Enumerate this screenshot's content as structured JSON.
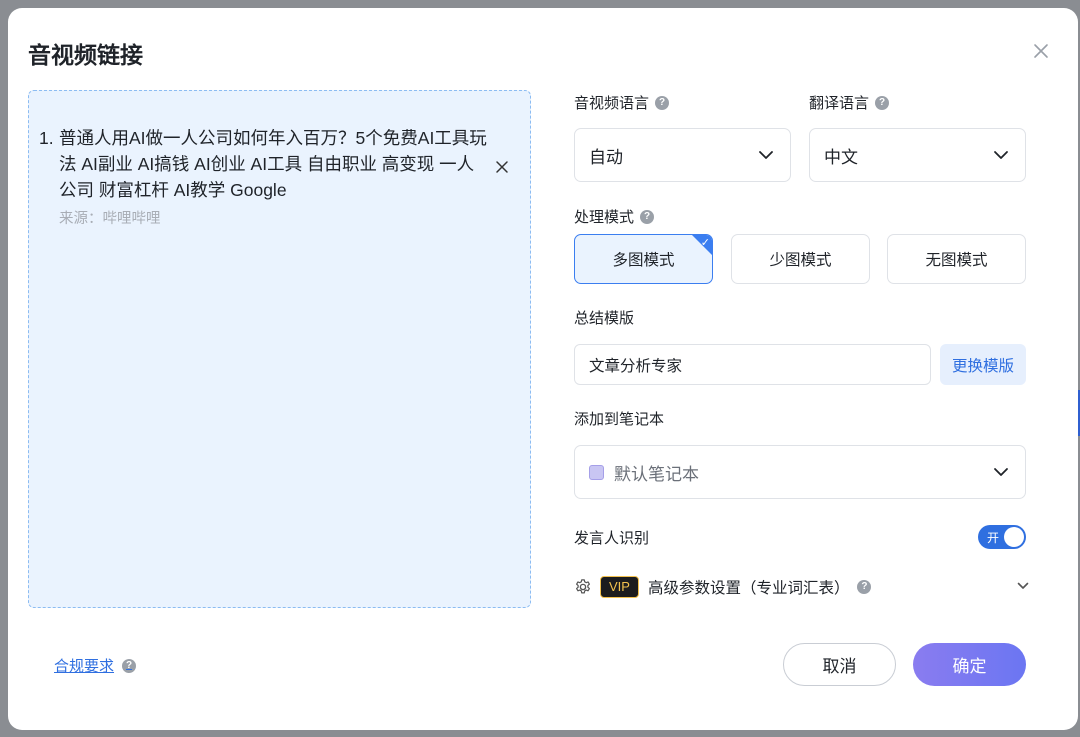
{
  "dialog": {
    "title": "音视频链接"
  },
  "link_list": {
    "items": [
      {
        "number": "1.",
        "title": "普通人用AI做一人公司如何年入百万？5个免费AI工具玩法 AI副业 AI搞钱 AI创业 AI工具 自由职业 高变现 一人公司 财富杠杆 AI教学 Google",
        "source": "来源：哔哩哔哩"
      }
    ]
  },
  "settings": {
    "audio_language": {
      "label": "音视频语言",
      "value": "自动"
    },
    "translate_language": {
      "label": "翻译语言",
      "value": "中文"
    },
    "process_mode": {
      "label": "处理模式",
      "options": [
        "多图模式",
        "少图模式",
        "无图模式"
      ],
      "selected": "多图模式"
    },
    "summary_template": {
      "label": "总结模版",
      "value": "文章分析专家",
      "change_button": "更换模版"
    },
    "notebook": {
      "label": "添加到笔记本",
      "value": "默认笔记本",
      "icon": "notebook-icon"
    },
    "speaker_recognition": {
      "label": "发言人识别",
      "toggle_text": "开",
      "enabled": true
    },
    "advanced": {
      "badge": "VIP",
      "label": "高级参数设置（专业词汇表）"
    }
  },
  "footer": {
    "compliance_link": "合规要求",
    "cancel_label": "取消",
    "confirm_label": "确定"
  },
  "colors": {
    "accent": "#2f6fe0",
    "panel_bg": "#eaf3fe",
    "confirm_gradient_start": "#8a7cf0",
    "confirm_gradient_end": "#6b76f2",
    "vip_gold": "#f2c14e"
  }
}
